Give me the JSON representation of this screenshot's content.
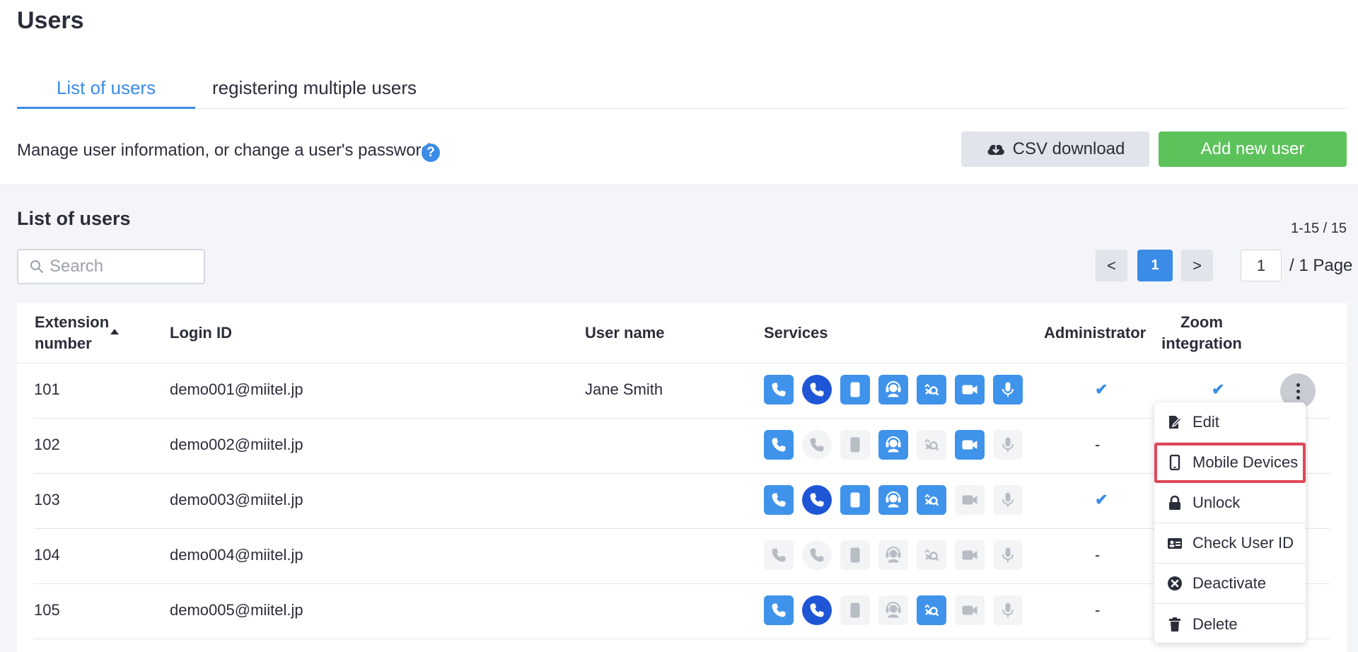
{
  "page": {
    "title": "Users",
    "tabs": [
      {
        "label": "List of users"
      },
      {
        "label": "registering multiple users"
      }
    ],
    "description": "Manage user information, or change a user's password.",
    "help_icon": "question-circle-icon",
    "csv_button": "CSV download",
    "add_button": "Add new user"
  },
  "list": {
    "title": "List of users",
    "count": "1-15 / 15",
    "search_placeholder": "Search",
    "pagination": {
      "prev": "<",
      "current": "1",
      "next": ">",
      "page_input": "1",
      "total": "/ 1 Page"
    },
    "columns": [
      "Extension\nnumber",
      "Login ID",
      "User name",
      "Services",
      "Administrator",
      "Zoom\nintegration"
    ],
    "service_icons": [
      "phone-icon",
      "call-icon",
      "mobile-icon",
      "agent-icon",
      "call-search-icon",
      "video-icon",
      "mic-icon"
    ],
    "rows": [
      {
        "ext": "101",
        "login": "demo001@miitel.jp",
        "name": "Jane Smith",
        "services": [
          true,
          true,
          true,
          true,
          true,
          true,
          true
        ],
        "admin": "✔",
        "zoom": "✔"
      },
      {
        "ext": "102",
        "login": "demo002@miitel.jp",
        "name": "",
        "services": [
          true,
          false,
          false,
          true,
          false,
          true,
          false
        ],
        "admin": "-",
        "zoom": ""
      },
      {
        "ext": "103",
        "login": "demo003@miitel.jp",
        "name": "",
        "services": [
          true,
          true,
          true,
          true,
          true,
          false,
          false
        ],
        "admin": "✔",
        "zoom": ""
      },
      {
        "ext": "104",
        "login": "demo004@miitel.jp",
        "name": "",
        "services": [
          false,
          false,
          false,
          false,
          false,
          false,
          false
        ],
        "admin": "-",
        "zoom": ""
      },
      {
        "ext": "105",
        "login": "demo005@miitel.jp",
        "name": "",
        "services": [
          true,
          true,
          false,
          false,
          true,
          false,
          false
        ],
        "admin": "-",
        "zoom": ""
      }
    ]
  },
  "menu": {
    "items": [
      {
        "label": "Edit",
        "icon": "edit-icon"
      },
      {
        "label": "Mobile Devices",
        "icon": "mobile-device-icon"
      },
      {
        "label": "Unlock",
        "icon": "lock-icon"
      },
      {
        "label": "Check User ID",
        "icon": "id-card-icon"
      },
      {
        "label": "Deactivate",
        "icon": "deactivate-icon"
      },
      {
        "label": "Delete",
        "icon": "trash-icon"
      }
    ],
    "highlighted": "Mobile Devices"
  },
  "colors": {
    "accent": "#3b8ce6",
    "service_on": "#3f93ea",
    "service_on_dark": "#1f56d6",
    "add_button": "#5cc35a",
    "highlight": "#e0475a"
  }
}
